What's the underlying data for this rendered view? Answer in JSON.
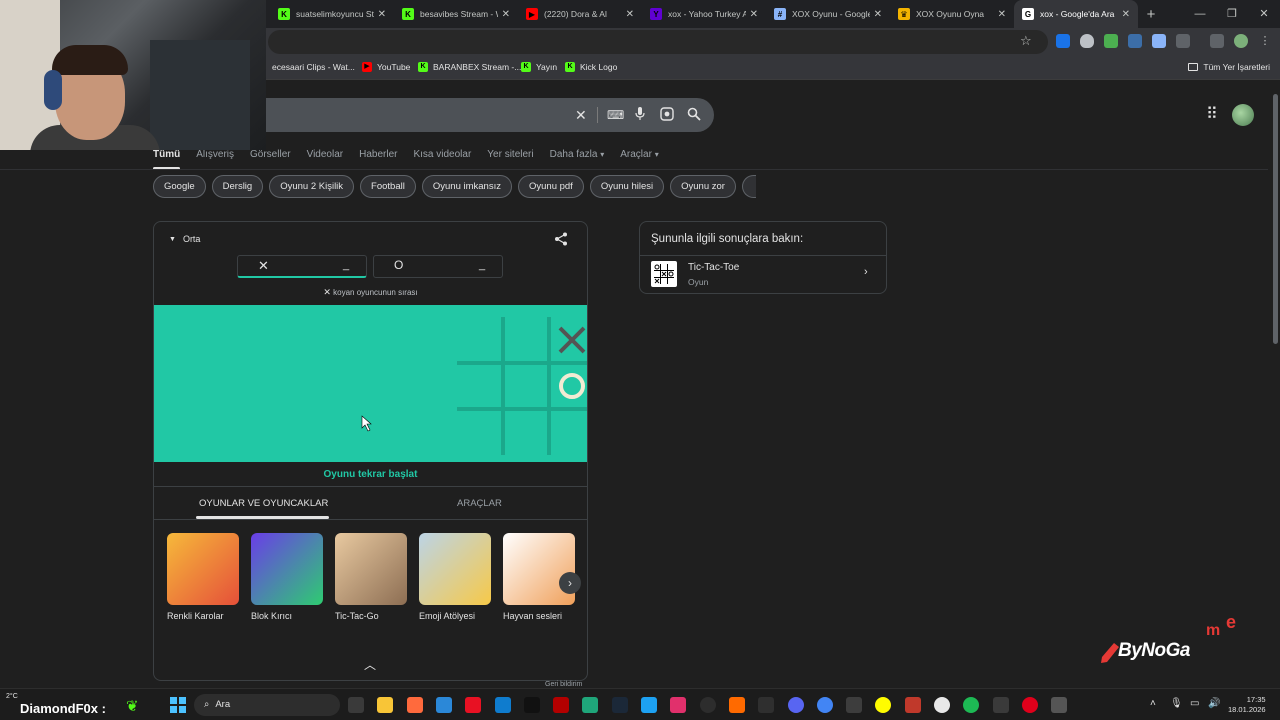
{
  "browser": {
    "tabs": [
      {
        "title": "suatselimkoyuncu St",
        "fav_color": "#53fc18",
        "fav_glyph": "K"
      },
      {
        "title": "besavibes Stream - W",
        "fav_color": "#53fc18",
        "fav_glyph": "K"
      },
      {
        "title": "(2220) Dora & Al",
        "fav_color": "#ff0000",
        "fav_glyph": "▶"
      },
      {
        "title": "xox - Yahoo Turkey A",
        "fav_color": "#6001d2",
        "fav_glyph": "Y"
      },
      {
        "title": "XOX Oyunu - Google",
        "fav_color": "#8ab4f8",
        "fav_glyph": "#"
      },
      {
        "title": "XOX Oyunu Oyna",
        "fav_color": "#f4b400",
        "fav_glyph": "♛"
      },
      {
        "title": "xox - Google'da Ara",
        "fav_color": "#ffffff",
        "fav_glyph": "G",
        "active": true
      }
    ],
    "new_tab_label": "+",
    "bookmarks": [
      {
        "label": "ecesaari Clips - Wat...",
        "fav_color": "#9146ff",
        "fav_glyph": ""
      },
      {
        "label": "YouTube",
        "fav_color": "#ff0000",
        "fav_glyph": "▶"
      },
      {
        "label": "BARANBEX Stream -...",
        "fav_color": "#53fc18",
        "fav_glyph": "K"
      },
      {
        "label": "Yayın",
        "fav_color": "#53fc18",
        "fav_glyph": "K"
      },
      {
        "label": "Kick Logo",
        "fav_color": "#53fc18",
        "fav_glyph": "K"
      }
    ],
    "all_bookmarks_label": "Tüm Yer İşaretleri"
  },
  "search": {
    "nav_tabs": [
      "Tümü",
      "Alışveriş",
      "Görseller",
      "Videolar",
      "Haberler",
      "Kısa videolar",
      "Yer siteleri",
      "Daha fazla",
      "Araçlar"
    ],
    "more_caret": "▾",
    "chips": [
      "Google",
      "Derslig",
      "Oyunu 2 Kişilik",
      "Football",
      "Oyunu imkansız",
      "Oyunu pdf",
      "Oyunu hilesi",
      "Oyunu zor"
    ]
  },
  "game": {
    "difficulty": "Orta",
    "player_x": {
      "symbol": "✕",
      "score": "_"
    },
    "player_o": {
      "symbol": "O",
      "score": "_"
    },
    "turn_symbol": "✕",
    "turn_text": "koyan oyuncunun sırası",
    "cells": [
      "",
      "",
      "X",
      "",
      "",
      "O",
      "",
      "",
      ""
    ],
    "board_color": "#21c8a5",
    "restart_label": "Oyunu tekrar başlat",
    "section_tabs": [
      "OYUNLAR VE OYUNCAKLAR",
      "ARAÇLAR"
    ],
    "games": [
      {
        "name": "Renkli Karolar",
        "colors": [
          "#f6b93b",
          "#e55039"
        ]
      },
      {
        "name": "Blok Kırıcı",
        "colors": [
          "#6a3de8",
          "#2ecc71"
        ]
      },
      {
        "name": "Tic-Tac-Go",
        "colors": [
          "#e8c9a0",
          "#8d6e53"
        ]
      },
      {
        "name": "Emoji Atölyesi",
        "colors": [
          "#bcd4e6",
          "#f7c948"
        ]
      },
      {
        "name": "Hayvan sesleri",
        "colors": [
          "#ffffff",
          "#f0a05a"
        ]
      }
    ],
    "feedback": "Geri bildirim"
  },
  "related": {
    "title": "Şununla ilgili sonuçlara bakın:",
    "item_name": "Tic-Tac-Toe",
    "item_sub": "Oyun"
  },
  "overlay": {
    "logo_main": "ByNoGa",
    "logo_m": "m",
    "logo_e": "e"
  },
  "taskbar": {
    "temperature": "2°C",
    "streamer": "DiamondF0x :",
    "search_placeholder": "Ara",
    "time": "17:35",
    "date": "18.01.2026"
  },
  "colors": {
    "accent": "#21c8a5",
    "page_bg": "#1f1f1f"
  }
}
